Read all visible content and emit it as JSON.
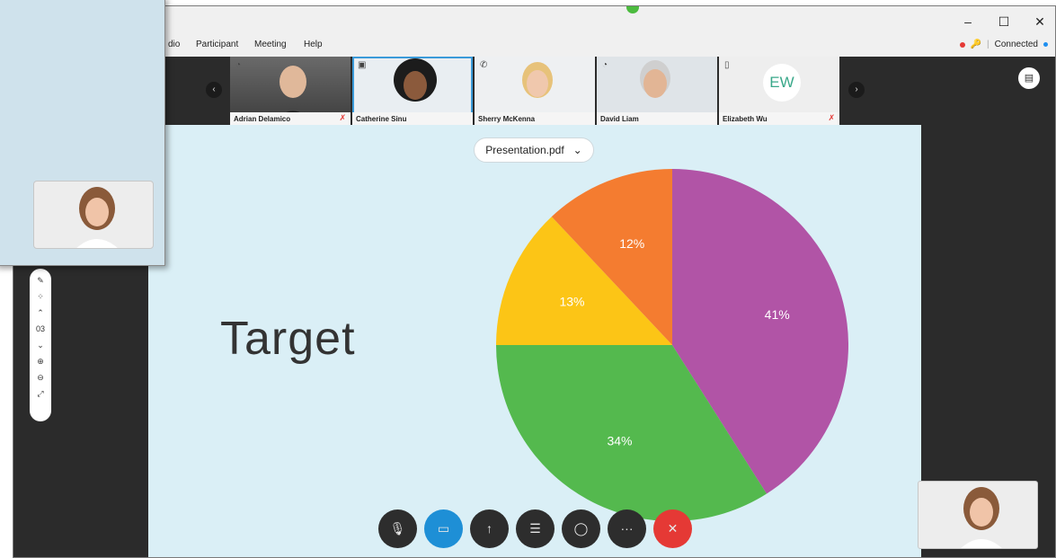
{
  "window": {
    "minimize": "–",
    "maximize": "☐",
    "close": "✕"
  },
  "menu": {
    "items": [
      "dio",
      "Participant",
      "Meeting",
      "Help"
    ]
  },
  "status": {
    "connection": "Connected"
  },
  "participants": [
    {
      "name": "Adrian Delamico",
      "muted": true,
      "icon": "headset-icon"
    },
    {
      "name": "Catherine Sinu",
      "muted": false,
      "icon": "room-icon",
      "selected": true
    },
    {
      "name": "Sherry McKenna",
      "muted": false,
      "icon": "phone-icon"
    },
    {
      "name": "David Liam",
      "muted": false,
      "icon": "headset-icon"
    },
    {
      "name": "Elizabeth Wu",
      "muted": true,
      "icon": "mobile-icon",
      "initials": "EW"
    }
  ],
  "presentation": {
    "file": "Presentation.pdf",
    "title": "Target"
  },
  "toolbar": {
    "page": "03"
  },
  "chart_data": {
    "type": "pie",
    "slices": [
      {
        "label": "41%",
        "value": 41,
        "color": "#b154a6"
      },
      {
        "label": "34%",
        "value": 34,
        "color": "#54b94e"
      },
      {
        "label": "13%",
        "value": 13,
        "color": "#fcc516"
      },
      {
        "label": "12%",
        "value": 12,
        "color": "#f47c30"
      }
    ]
  },
  "colors": {
    "accent": "#1e8fd6",
    "end_call": "#e53935",
    "connected": "#1e8ff0"
  }
}
